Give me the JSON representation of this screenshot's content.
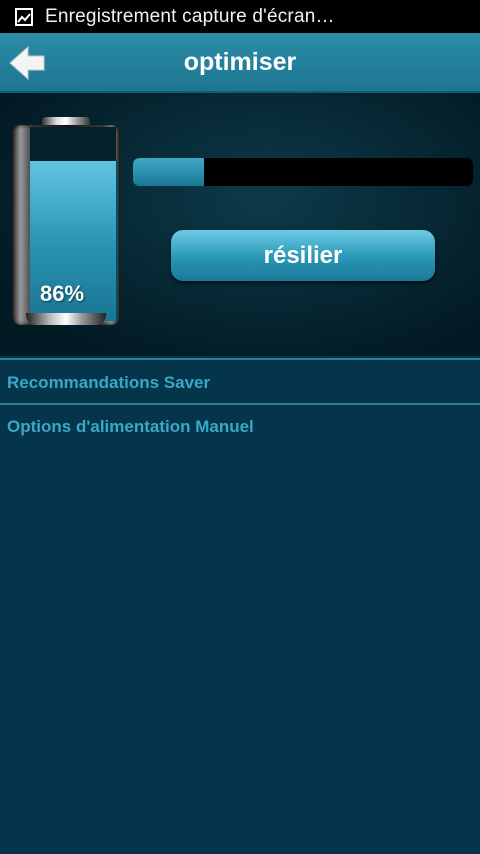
{
  "status_bar": {
    "text": "Enregistrement capture d'écran…",
    "icon": "screenshot-icon"
  },
  "header": {
    "title": "optimiser",
    "back_icon": "back-arrow-icon"
  },
  "battery": {
    "level_label": "86%",
    "level_fraction": 0.86
  },
  "progress": {
    "fraction": 0.21
  },
  "action_button": {
    "label": "résilier"
  },
  "menu": {
    "items": [
      {
        "label": "Recommandations Saver"
      },
      {
        "label": "Options d'alimentation Manuel"
      }
    ]
  },
  "colors": {
    "background": "#05354a",
    "title_bar": "#1d7691",
    "accent_text": "#3aa7c6",
    "status_bar": "#000000"
  }
}
